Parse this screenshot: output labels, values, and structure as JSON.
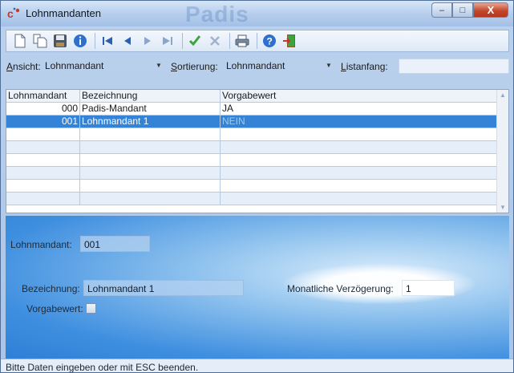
{
  "window": {
    "title": "Lohnmandanten",
    "watermark": "Padis",
    "minimize": "–",
    "maximize": "□",
    "close": "X"
  },
  "toolbar": {
    "icons": [
      "new-document-icon",
      "copy-document-icon",
      "save-disk-icon",
      "info-icon",
      "first-record-icon",
      "previous-record-icon",
      "next-record-icon",
      "last-record-icon",
      "confirm-check-icon",
      "cancel-x-icon",
      "print-icon",
      "help-icon",
      "exit-door-icon"
    ]
  },
  "filter": {
    "ansicht_label_u": "A",
    "ansicht_label_rest": "nsicht:",
    "ansicht_value": "Lohnmandant",
    "sortierung_label_u": "S",
    "sortierung_label_rest": "ortierung:",
    "sortierung_value": "Lohnmandant",
    "listanfang_label_u": "L",
    "listanfang_label_rest": "istanfang:",
    "listanfang_value": ""
  },
  "grid": {
    "columns": [
      "Lohnmandant",
      "Bezeichnung",
      "Vorgabewert"
    ],
    "rows": [
      {
        "nr": "000",
        "bezeichnung": "Padis-Mandant",
        "vorgabewert": "JA"
      },
      {
        "nr": "001",
        "bezeichnung": "Lohnmandant 1",
        "vorgabewert": "NEIN"
      }
    ]
  },
  "detail": {
    "lohnmandant_label": "Lohnmandant:",
    "lohnmandant_value": "001",
    "bezeichnung_label": "Bezeichnung:",
    "bezeichnung_value": "Lohnmandant 1",
    "verzoegerung_label": "Monatliche Verzögerung:",
    "verzoegerung_value": "1",
    "vorgabewert_label": "Vorgabewert:",
    "vorgabewert_checked": false
  },
  "status": {
    "text": "Bitte Daten eingeben oder mit ESC beenden."
  }
}
